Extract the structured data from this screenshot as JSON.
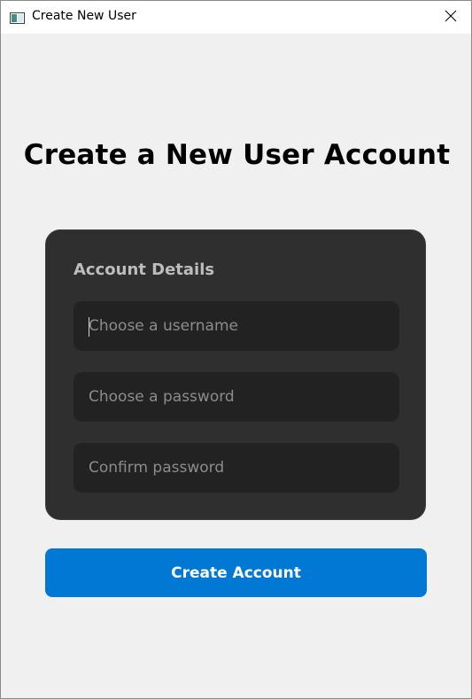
{
  "window": {
    "title": "Create New User",
    "icon": "app-window-icon",
    "close_icon": "close-icon"
  },
  "page": {
    "heading": "Create a New User Account"
  },
  "account_details": {
    "title": "Account Details",
    "username": {
      "value": "",
      "placeholder": "Choose a username",
      "focused": true
    },
    "password": {
      "value": "",
      "placeholder": "Choose a password"
    },
    "confirm_password": {
      "value": "",
      "placeholder": "Confirm password"
    }
  },
  "actions": {
    "create_account_label": "Create Account"
  },
  "colors": {
    "accent": "#0078d4",
    "card_background": "#2f2f2f",
    "field_background": "#222222",
    "window_background": "#f0f0f0"
  }
}
